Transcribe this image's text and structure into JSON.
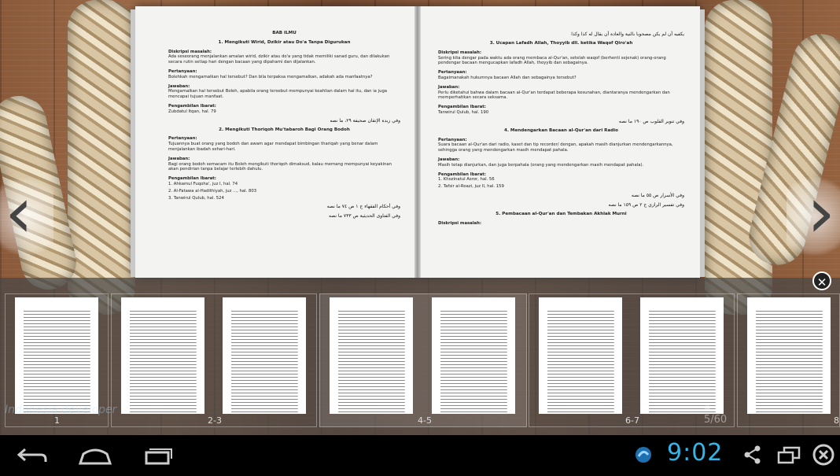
{
  "left_page": {
    "title": "BAB ILMU",
    "section1": "1.     Mengikuti Wirid, Dzikir atau Do'a Tanpa Digurukan",
    "desk_label": "Diskripsi masalah:",
    "desk_text": "Ada seseorang menjalankan amalan wirid, dzikir atau do'a yang tidak memiliki sanad guru, dan dilakukan secara rutin setiap hari dengan bacaan yang dipahami dan dijalankan.",
    "tanya_label": "Pertanyaan:",
    "tanya_text": "Bolehkah mengamalkan hal tersebut? Dan bila terpaksa mengamalkan, adakah ada manfaatnya?",
    "jawab_label": "Jawaban:",
    "jawab_text": "Mengamalkan hal tersebut Boleh, apabila orang tersebut mempunyai keahlian dalam hal itu, dan ia juga mencapai tujuan manfaat.",
    "ref_label": "Pengambilan Ibarat:",
    "ref_text": "Zubdatul Itqan, hal. 79",
    "ar1": "وفي زبدة الإتقان صحيفة ٢٩، ما نصه",
    "section2": "2.     Mengikuti Thoriqoh Mu'tabaroh Bagi Orang Bodoh",
    "desk2": "Tujuannya buat orang yang bodoh dan awam agar mendapat bimbingan thariqah yang benar dalam menjalankan ibadah sehari-hari.",
    "jawab2": "Bagi orang bodoh semacam itu Boleh mengikuti thoriqoh dimaksud, kalau memang mempunyai keyakinan akan pendirian tanpa belajar terlebih dahulu.",
    "ref2a": "1.   Ahkamul Fuqoha', juz I, hal. 74",
    "ref2b": "2.   Al-Fatawa al-Hadithiyah, juz ..., hal. 803",
    "ref2c": "3.   Tanwirul Qulub, hal. 524",
    "ar2": "وفي أحكام الفقهاء ج ١ ص ٧٤ ما نصه",
    "ar3": "وفي الفتاوى الحديثية ص ٧٣٣ ما نصه"
  },
  "right_page": {
    "ar_top": "يكفيه أن لم يكن مصحوبا بالنية والعادة أن يقال له كذا وكذا",
    "section3": "3.     Ucapan Lafadh Allah, Thoyyib dll. ketika Waqof Qiro'ah",
    "desk_label": "Diskripsi masalah:",
    "desk_text": "Sering kita dengar pada waktu ada orang membaca al-Qur'an, setelah waqof (berhenti sejenak) orang-orang pendengar bacaan mengucapkan lafadh Allah, thoyyib dan sebagainya.",
    "tanya_label": "Pertanyaan:",
    "tanya_text": "Bagaimanakah hukumnya bacaan Allah dan sebagainya tersebut?",
    "jawab_label": "Jawaban:",
    "jawab_text": "Perlu diketahui bahwa dalam bacaan al-Qur'an terdapat beberapa kesunahan, diantaranya mendengarkan dan memperhatikan secara seksama.",
    "ref_label": "Pengambilan Ibarat:",
    "ref_text": "Tanwirul Qulub, hal. 190",
    "ar1": "وفي تنوير القلوب ص ١٩٠ ما نصه",
    "section4": "4.     Mendengarkan Bacaan al-Qur'an dari Radio",
    "desk4": "Suara bacaan al-Qur'an dari radio, kaset dan tip recorder/ dengan, apakah masih dianjurkan mendengarkannya, sehingga orang yang mendengarkan masih mendapat pahala.",
    "jawab4": "Masih tetap dianjurkan, dan juga berpahala (orang yang mendengarkan masih mendapat pahala).",
    "ref4a": "1.   Khozinatul Asror, hal. 56",
    "ref4b": "2.   Tafsir al-Roazi, juz II, hal. 159",
    "ar2": "وفي الأسرار ص ٥٥ ما نصه",
    "ar3": "وفي تفسير الرازي ج ٢ ص ١٥٩ ما نصه",
    "section5": "5.     Pembacaan al-Qur'an dan Tembakan Akhlak Murni",
    "desk_label2": "Diskripsi masalah:"
  },
  "thumbnails": [
    {
      "label": "1"
    },
    {
      "label": "2-3"
    },
    {
      "label": "4-5"
    },
    {
      "label": "6-7"
    },
    {
      "label": "8"
    }
  ],
  "overlay_page_counter": "4-5/60",
  "clock": "9:02",
  "watermark": "Indonesia developer",
  "icons": {
    "prev": "chevron-left-icon",
    "next": "chevron-right-icon",
    "close": "close-icon",
    "back": "back-icon",
    "home": "home-icon",
    "recent": "recent-apps-icon",
    "notification": "app-notification-icon",
    "share": "share-icon",
    "window": "window-icon",
    "exit": "exit-icon"
  },
  "colors": {
    "clock": "#33b5e5",
    "strip": "#464646",
    "navbar": "#000000"
  }
}
